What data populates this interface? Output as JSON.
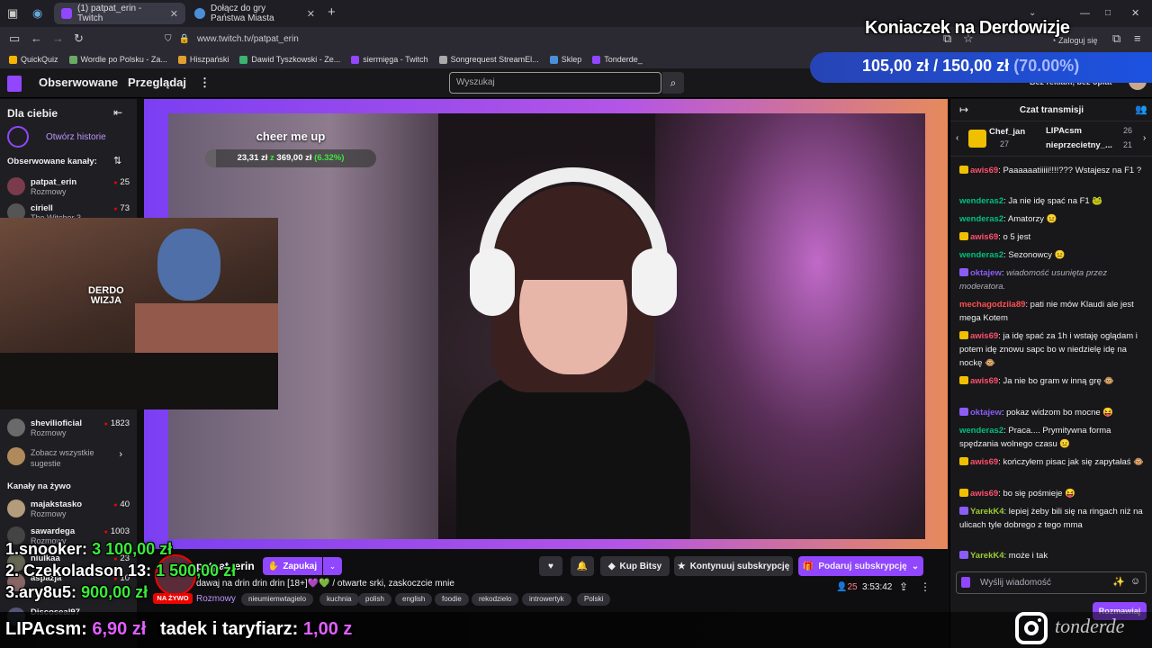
{
  "tabs": [
    {
      "label": "(1) patpat_erin - Twitch",
      "color": "#9146ff"
    },
    {
      "label": "Dołącz do gry Państwa Miasta",
      "color": "#4a90d9"
    }
  ],
  "url": "www.twitch.tv/patpat_erin",
  "account_label": "Zaloguj się",
  "bookmarks": [
    "QuickQuiz",
    "Wordle po Polsku - Za...",
    "Hiszpański",
    "Dawid Tyszkowski - Ze...",
    "siermięga - Twitch",
    "Songrequest StreamEl...",
    "Sklep",
    "Tonderde_"
  ],
  "nav": {
    "following": "Obserwowane",
    "browse": "Przeglądaj",
    "search_placeholder": "Wyszukaj",
    "adfree": "Bez reklam, bez opłat"
  },
  "sidebar": {
    "title": "Dla ciebie",
    "stories": "Otwórz historie",
    "followed_header": "Obserwowane kanały:",
    "followed": [
      {
        "name": "patpat_erin",
        "category": "Rozmowy",
        "viewers": "25"
      },
      {
        "name": "ciriell",
        "category": "The Witcher 3",
        "viewers": "73"
      },
      {
        "name": "shevilioficial",
        "category": "Rozmowy",
        "viewers": "1823"
      }
    ],
    "see_all": "Zobacz wszystkie sugestie",
    "live_header": "Kanały na żywo",
    "live": [
      {
        "name": "majakstasko",
        "category": "Rozmowy",
        "viewers": "40"
      },
      {
        "name": "sawardega",
        "category": "Rozmowy",
        "viewers": "1003"
      },
      {
        "name": "niulkaa",
        "category": "",
        "viewers": "23"
      },
      {
        "name": "aspazja",
        "category": "",
        "viewers": "10"
      },
      {
        "name": "Discoseal97",
        "category": "",
        "viewers": ""
      }
    ]
  },
  "video": {
    "goal_title": "cheer me up",
    "goal_current": "23,31 zł",
    "goal_sep": "z",
    "goal_total": "369,00 zł",
    "goal_pct": "(6.32%)",
    "goal_fraction": 0.0632,
    "pip_logo_line1": "DERDO",
    "pip_logo_line2": "WIZJA"
  },
  "channel": {
    "name": "patpat_erin",
    "live_badge": "NA ŻYWO",
    "follow": "Zapukaj",
    "title": "dawaj na drin drin drin [18+]💜💚 / otwarte srki, zaskoczcie mnie",
    "category": "Rozmowy",
    "tags": [
      "nieumiemwtagielo",
      "kuchnia",
      "polish",
      "english",
      "foodie",
      "rekodzielo",
      "introwertyk",
      "Polski"
    ],
    "viewers": "25",
    "uptime": "3:53:42",
    "buy_bits": "Kup Bitsy",
    "continue_sub": "Kontynuuj subskrypcję",
    "gift_sub": "Podaruj subskrypcję"
  },
  "chat": {
    "title": "Czat transmisji",
    "gifters": [
      {
        "name": "Chef_jan",
        "count": "27"
      },
      {
        "name": "LIPAcsm",
        "count": "26"
      },
      {
        "name": "nieprzecietny_...",
        "count": "21"
      }
    ],
    "messages": [
      {
        "user": "awis69",
        "color": "#ff4f6d",
        "text": "Paaaaaatiiiii!!!!??? Wstajesz na F1 ?"
      },
      {
        "user": "wenderas2",
        "color": "#00c07a",
        "text": "Ja nie idę spać na F1 🐸"
      },
      {
        "user": "wenderas2",
        "color": "#00c07a",
        "text": "Amatorzy 😐"
      },
      {
        "user": "awis69",
        "color": "#ff4f6d",
        "text": "o 5 jest"
      },
      {
        "user": "wenderas2",
        "color": "#00c07a",
        "text": "Sezonowcy 😐"
      },
      {
        "user": "oktajew",
        "color": "#8b5cf6",
        "text": "wiadomość usunięta przez moderatora.",
        "deleted": true
      },
      {
        "user": "mechagodzila89",
        "color": "#ff4f4f",
        "text": "pati nie mów Klaudi ale jest mega Kotem"
      },
      {
        "user": "awis69",
        "color": "#ff4f6d",
        "text": "ja idę spać za 1h i wstaję oglądam i potem idę znowu sapc bo w niedzielę idę na nockę 🐵"
      },
      {
        "user": "awis69",
        "color": "#ff4f6d",
        "text": "Ja nie bo gram w inną grę 🐵"
      },
      {
        "user": "oktajew",
        "color": "#8b5cf6",
        "text": "pokaz widzom bo mocne 😝"
      },
      {
        "user": "wenderas2",
        "color": "#00c07a",
        "text": "Praca.... Prymitywna forma spędzania wolnego czasu 😐"
      },
      {
        "user": "awis69",
        "color": "#ff4f6d",
        "text": "kończyłem pisac jak się zapytałaś 🐵"
      },
      {
        "user": "awis69",
        "color": "#ff4f6d",
        "text": "bo się pośmieje 😝"
      },
      {
        "user": "YarekK4",
        "color": "#9acd32",
        "text": "lepiej żeby bili się na ringach niż na ulicach tyle dobrego z tego mma"
      },
      {
        "user": "YarekK4",
        "color": "#9acd32",
        "text": "może i tak"
      }
    ],
    "input_placeholder": "Wyślij wiadomość",
    "chat_button": "Rozmawiaj"
  },
  "overlay": {
    "title": "Koniaczek na Derdowizje",
    "goal_current": "105,00 zł",
    "goal_sep": "/",
    "goal_total": "150,00 zł",
    "goal_pct": "(70.00%)",
    "leaderboard": [
      {
        "rank": "1.",
        "name": "snooker:",
        "amount": "3 100,00 zł"
      },
      {
        "rank": "2.",
        "name": "Czekoladson 13:",
        "amount": "1 500,00 zł"
      },
      {
        "rank": "3.",
        "name": "ary8u5:",
        "amount": "900,00 zł"
      }
    ],
    "recent": [
      {
        "name": "LIPAcsm:",
        "amount": "6,90 zł"
      },
      {
        "name": "tadek i taryfiarz:",
        "amount": "1,00 z"
      }
    ],
    "ig_handle": "tonderde"
  },
  "colors": {
    "twitch_purple": "#9146ff",
    "live_red": "#eb0400",
    "goal_green": "#3bea3b",
    "gold": "#f0c000"
  }
}
